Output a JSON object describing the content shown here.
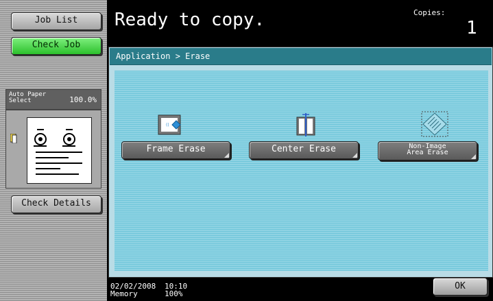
{
  "left_panel": {
    "job_list_label": "Job List",
    "check_job_label": "Check Job",
    "paper_label_line1": "Auto Paper",
    "paper_label_line2": "Select",
    "zoom_label": "100.0%",
    "check_details_label": "Check Details"
  },
  "header": {
    "status": "Ready to copy.",
    "copies_label": "Copies:",
    "copies_value": "1"
  },
  "main": {
    "breadcrumb": "Application > Erase",
    "buttons": {
      "frame_erase": "Frame Erase",
      "center_erase": "Center Erase",
      "non_image_line1": "Non-Image",
      "non_image_line2": "Area Erase"
    }
  },
  "footer": {
    "date": "02/02/2008",
    "memory_label": "Memory",
    "time": "10:10",
    "memory_value": "100%",
    "ok_label": "OK"
  },
  "colors": {
    "check_job_green": "#2cc02c",
    "breadcrumb_teal": "#2a7c8a",
    "content_blue": "#8fd3e3"
  }
}
